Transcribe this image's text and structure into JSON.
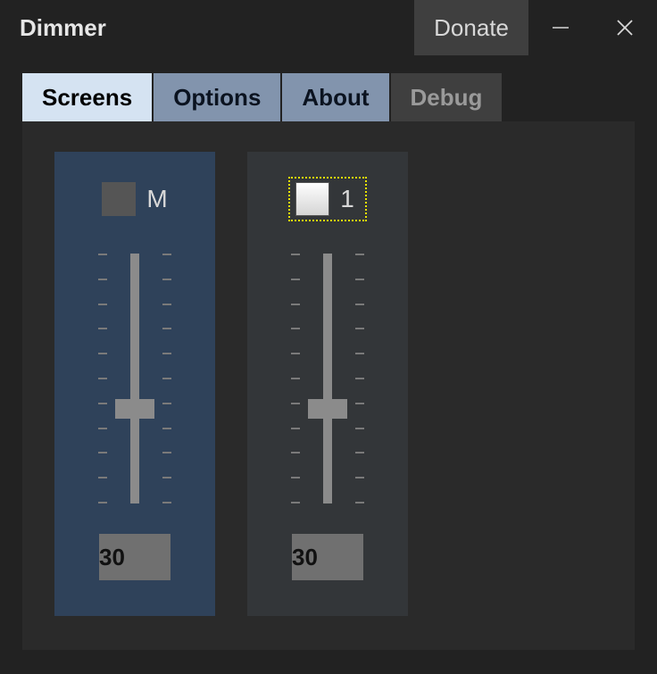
{
  "title": "Dimmer",
  "donate_label": "Donate",
  "tabs": [
    {
      "label": "Screens",
      "state": "active"
    },
    {
      "label": "Options",
      "state": "std"
    },
    {
      "label": "About",
      "state": "std"
    },
    {
      "label": "Debug",
      "state": "dim"
    }
  ],
  "screens": [
    {
      "id": "master",
      "label": "M",
      "value": 30,
      "slider_pos_percent": 63,
      "checked": false,
      "focused": false
    },
    {
      "id": "monitor1",
      "label": "1",
      "value": 30,
      "slider_pos_percent": 63,
      "checked": true,
      "focused": true
    }
  ],
  "slider": {
    "min": 0,
    "max": 100,
    "ticks": 11
  }
}
